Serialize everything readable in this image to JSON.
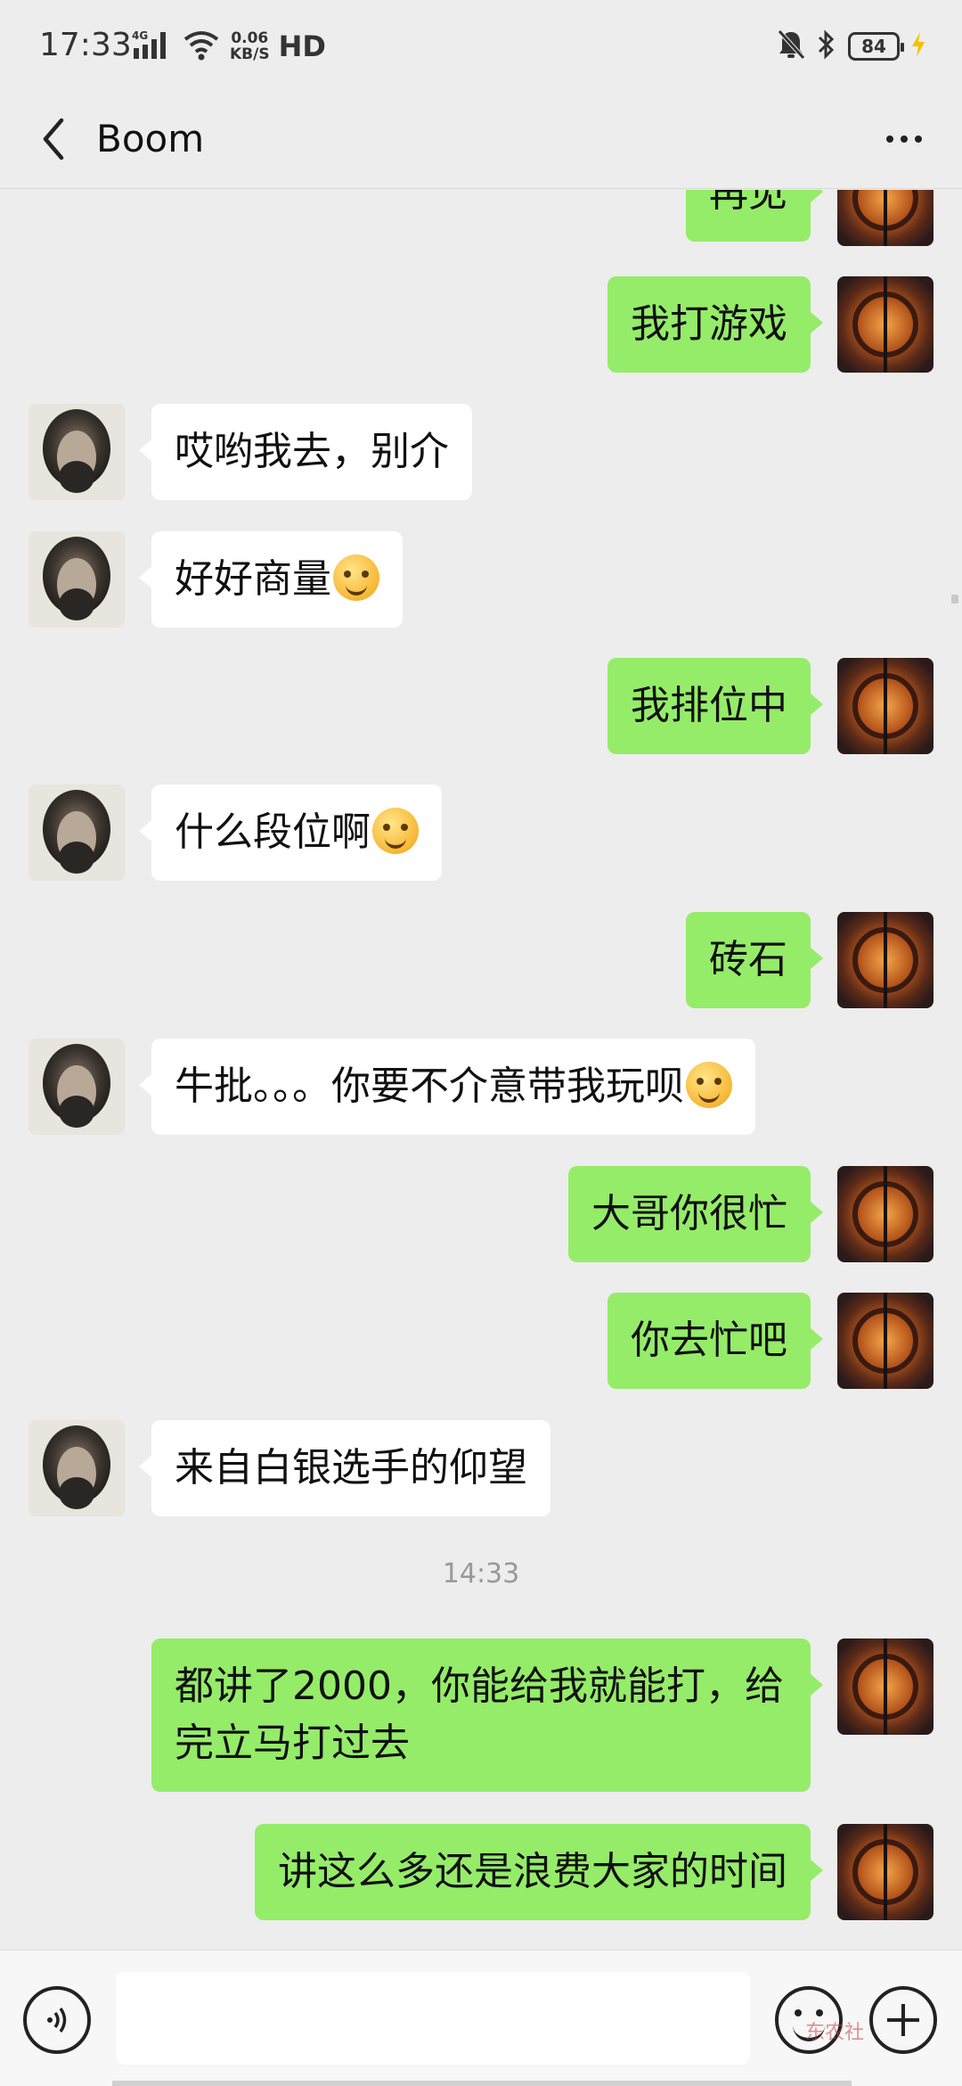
{
  "status_bar": {
    "time": "17:33",
    "network": "4G",
    "speed_value": "0.06",
    "speed_unit": "KB/S",
    "hd": "HD",
    "battery": "84"
  },
  "header": {
    "title": "Boom"
  },
  "messages": [
    {
      "side": "out",
      "text": "再见"
    },
    {
      "side": "out",
      "text": "我打游戏"
    },
    {
      "side": "in",
      "text": "哎哟我去，别介"
    },
    {
      "side": "in",
      "text": "好好商量",
      "emoji": "facepalm-emoji"
    },
    {
      "side": "out",
      "text": "我排位中"
    },
    {
      "side": "in",
      "text": "什么段位啊",
      "emoji": "smirk-emoji"
    },
    {
      "side": "out",
      "text": "砖石"
    },
    {
      "side": "in",
      "text": "牛批。。。你要不介意带我玩呗",
      "emoji": "laugh-cry-emoji"
    },
    {
      "side": "out",
      "text": "大哥你很忙"
    },
    {
      "side": "out",
      "text": "你去忙吧"
    },
    {
      "side": "in",
      "text": "来自白银选手的仰望"
    },
    {
      "side": "out",
      "text": "都讲了2000，你能给我就能打，给完立马打过去"
    },
    {
      "side": "out",
      "text": "讲这么多还是浪费大家的时间"
    }
  ],
  "timestamp": "14:33",
  "input_bar": {
    "value": "",
    "watermark": "东农社"
  },
  "colors": {
    "background": "#ededed",
    "outgoing_bubble": "#95ec69",
    "incoming_bubble": "#ffffff"
  }
}
